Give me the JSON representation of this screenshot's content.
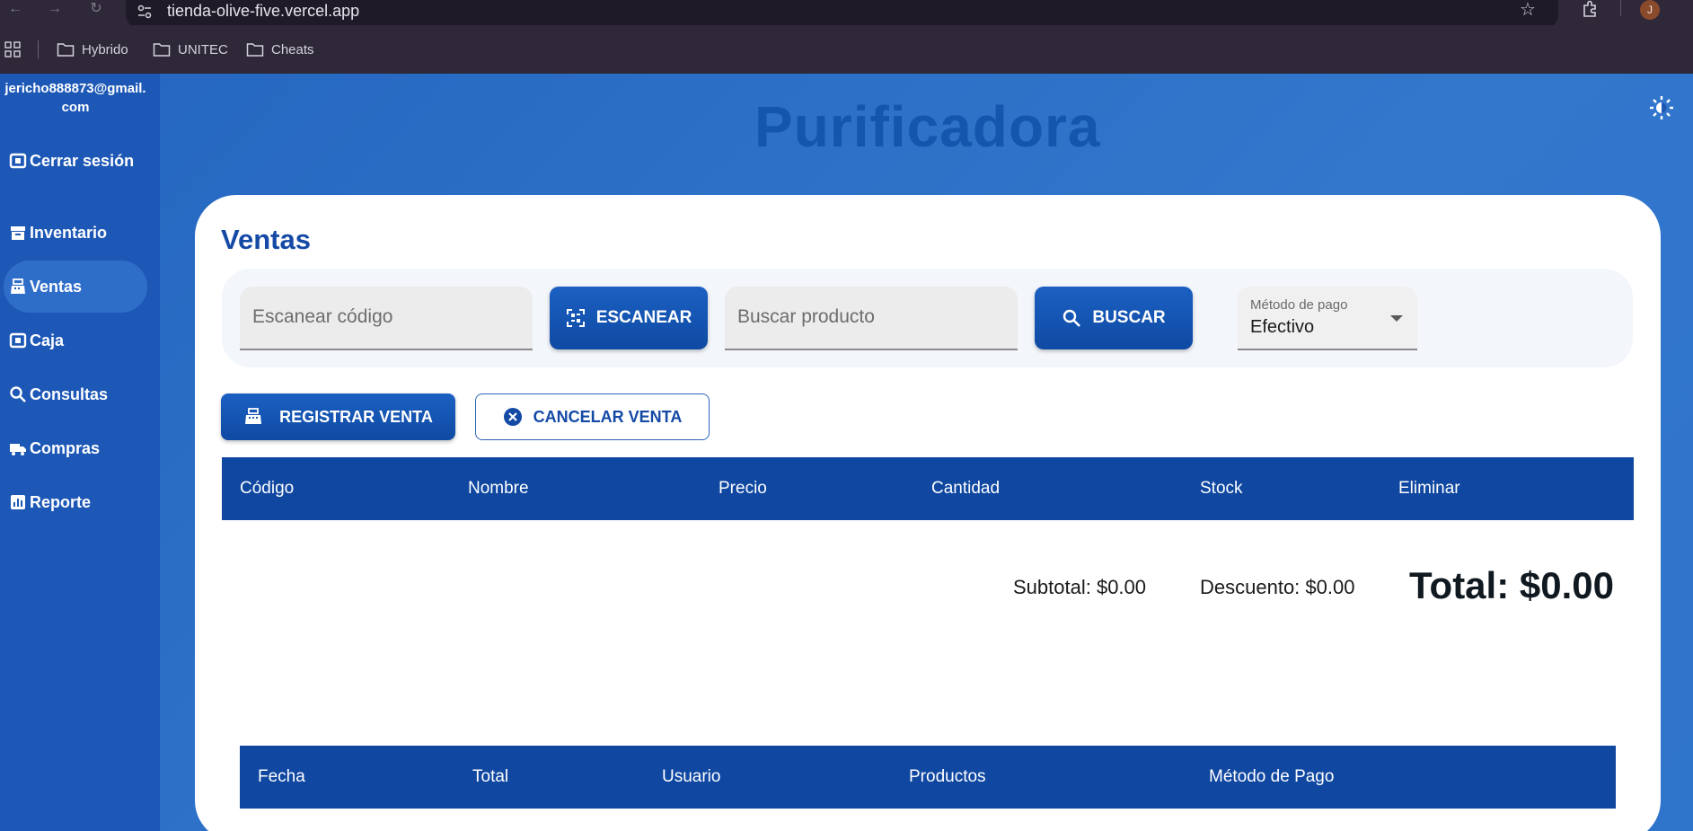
{
  "browser": {
    "url": "tienda-olive-five.vercel.app",
    "profile_initial": "J",
    "bookmarks": [
      "Hybrido",
      "UNITEC",
      "Cheats"
    ]
  },
  "sidebar": {
    "user_email": "jericho888873@gmail.com",
    "logout_label": "Cerrar sesión",
    "items": [
      {
        "label": "Inventario",
        "icon": "archive-icon"
      },
      {
        "label": "Ventas",
        "icon": "register-icon"
      },
      {
        "label": "Caja",
        "icon": "cash-icon"
      },
      {
        "label": "Consultas",
        "icon": "search-icon"
      },
      {
        "label": "Compras",
        "icon": "truck-icon"
      },
      {
        "label": "Reporte",
        "icon": "chart-icon"
      }
    ],
    "active_item": "Ventas"
  },
  "header": {
    "title": "Purificadora"
  },
  "sales": {
    "title": "Ventas",
    "scan_placeholder": "Escanear código",
    "scan_button": "ESCANEAR",
    "search_placeholder": "Buscar producto",
    "search_button": "BUSCAR",
    "payment_label": "Método de pago",
    "payment_value": "Efectivo",
    "register_button": "REGISTRAR VENTA",
    "cancel_button": "CANCELAR VENTA",
    "cart_columns": [
      "Código",
      "Nombre",
      "Precio",
      "Cantidad",
      "Stock",
      "Eliminar"
    ],
    "subtotal": "Subtotal: $0.00",
    "discount": "Descuento: $0.00",
    "total": "Total: $0.00",
    "history_columns": [
      "Fecha",
      "Total",
      "Usuario",
      "Productos",
      "Método de Pago"
    ]
  },
  "colors": {
    "brand_blue": "#0f47a1",
    "sidebar": "#1d58b6",
    "title": "#1455ad"
  }
}
